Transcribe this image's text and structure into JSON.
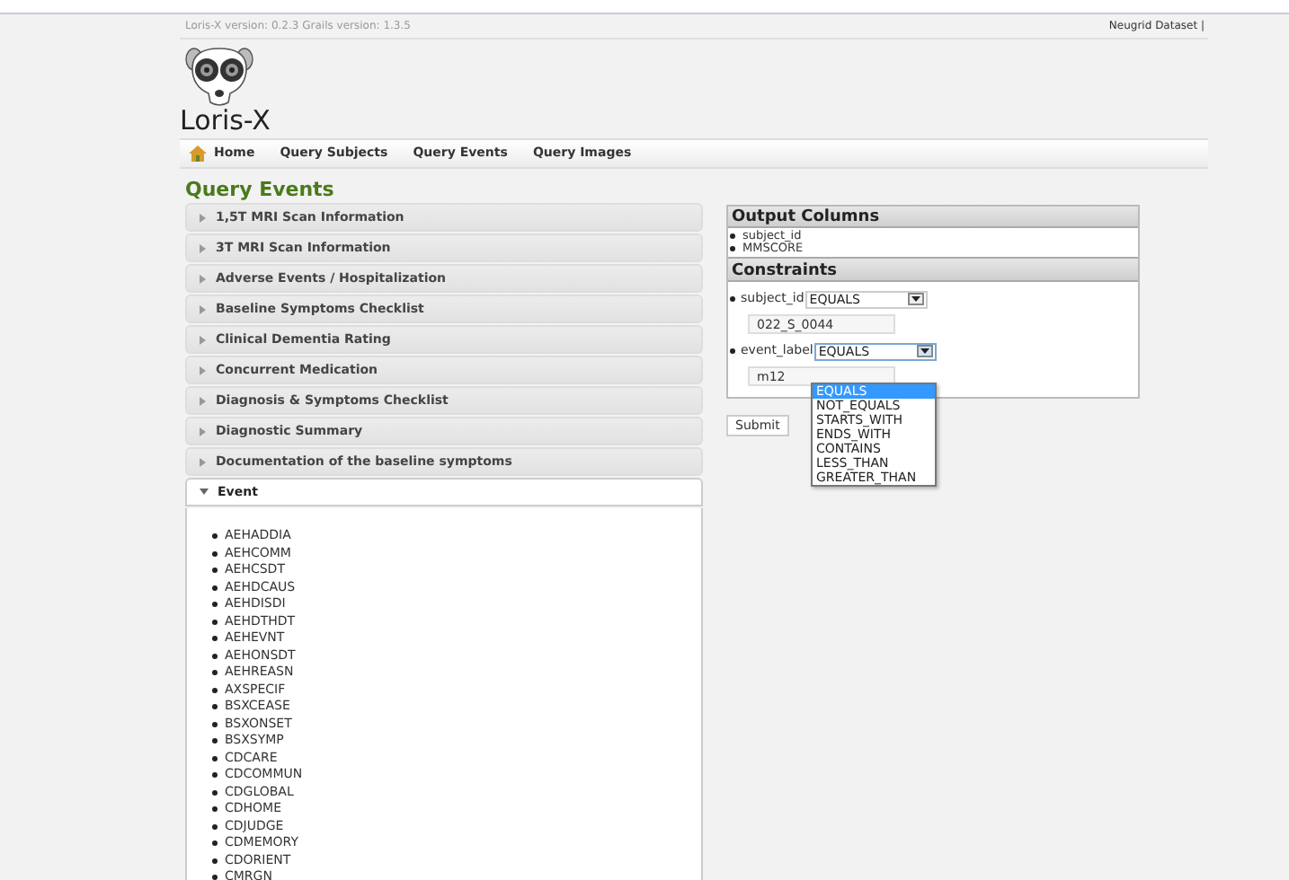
{
  "header": {
    "version": "Loris-X version: 0.2.3 Grails version: 1.3.5",
    "dataset": "Neugrid Dataset |",
    "app_name": "Loris-X"
  },
  "nav": [
    {
      "label": "Home",
      "kind": "home"
    },
    {
      "label": "Query Subjects",
      "kind": "link"
    },
    {
      "label": "Query Events",
      "kind": "link"
    },
    {
      "label": "Query Images",
      "kind": "link"
    }
  ],
  "page_title": "Query Events",
  "sections": [
    {
      "label": "1,5T MRI Scan Information",
      "expanded": false
    },
    {
      "label": "3T MRI Scan Information",
      "expanded": false
    },
    {
      "label": "Adverse Events / Hospitalization",
      "expanded": false
    },
    {
      "label": "Baseline Symptoms Checklist",
      "expanded": false
    },
    {
      "label": "Clinical Dementia Rating",
      "expanded": false
    },
    {
      "label": "Concurrent Medication",
      "expanded": false
    },
    {
      "label": "Diagnosis & Symptoms Checklist",
      "expanded": false
    },
    {
      "label": "Diagnostic Summary",
      "expanded": false
    },
    {
      "label": "Documentation of the baseline symptoms",
      "expanded": false
    },
    {
      "label": "Event",
      "expanded": true,
      "items": [
        "AEHADDIA",
        "AEHCOMM",
        "AEHCSDT",
        "AEHDCAUS",
        "AEHDISDI",
        "AEHDTHDT",
        "AEHEVNT",
        "AEHONSDT",
        "AEHREASN",
        "AXSPECIF",
        "BSXCEASE",
        "BSXONSET",
        "BSXSYMP",
        "CDCARE",
        "CDCOMMUN",
        "CDGLOBAL",
        "CDHOME",
        "CDJUDGE",
        "CDMEMORY",
        "CDORIENT",
        "CMRGN"
      ]
    }
  ],
  "output_columns": {
    "title": "Output Columns",
    "items": [
      "subject_id",
      "MMSCORE"
    ]
  },
  "constraints": {
    "title": "Constraints",
    "rows": [
      {
        "field": "subject_id",
        "operator": "EQUALS",
        "value": "022_S_0044",
        "open": false
      },
      {
        "field": "event_label",
        "operator": "EQUALS",
        "value": "m12",
        "open": true,
        "options": [
          {
            "label": "EQUALS",
            "selected": true
          },
          {
            "label": "NOT_EQUALS",
            "selected": false
          },
          {
            "label": "STARTS_WITH",
            "selected": false
          },
          {
            "label": "ENDS_WITH",
            "selected": false
          },
          {
            "label": "CONTAINS",
            "selected": false
          },
          {
            "label": "LESS_THAN",
            "selected": false
          },
          {
            "label": "GREATER_THAN",
            "selected": false
          }
        ]
      }
    ]
  },
  "submit": "Submit"
}
